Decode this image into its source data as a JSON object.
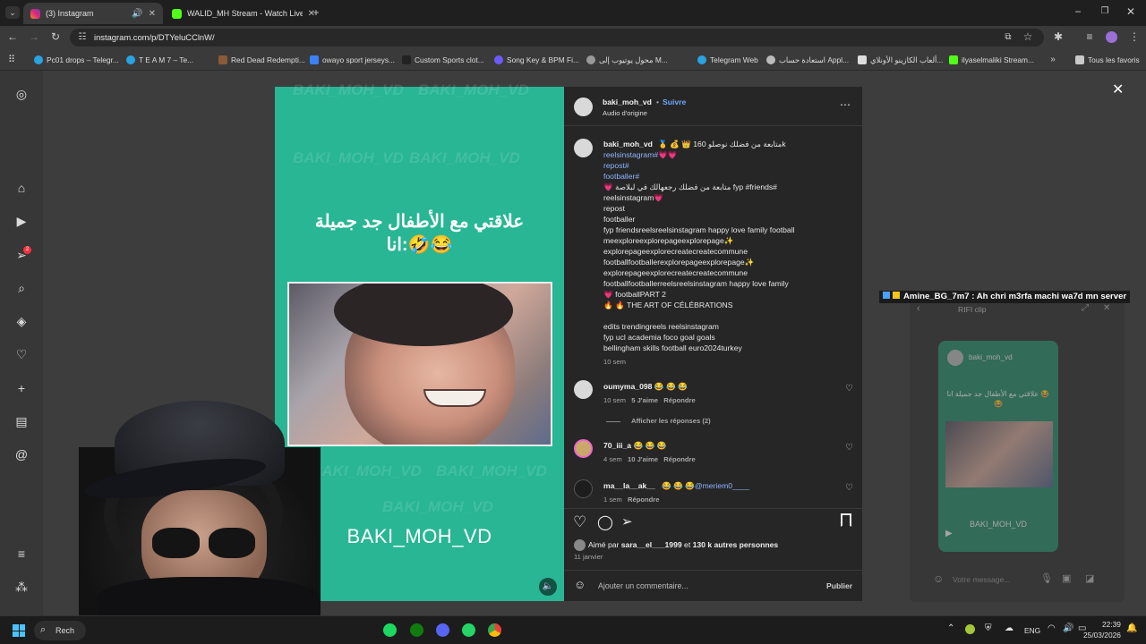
{
  "browser": {
    "tabs": [
      {
        "title": "(3) Instagram",
        "active": true
      },
      {
        "title": "WALID_MH Stream - Watch Live",
        "active": false
      }
    ],
    "url": "instagram.com/p/DTYeluCClnW/",
    "bookmarks": [
      "Pc01 drops – Telegr...",
      "T E A M 7 – Te...",
      "Red Dead Redempti...",
      "owayo sport jerseys...",
      "Custom Sports clot...",
      "Song Key & BPM Fi...",
      "محول يوتيوب إلى M...",
      "Telegram Web",
      "استعادة حساب Appl...",
      "ألعاب الكازينو الأونلاي...",
      "ilyaselmaliki Stream..."
    ],
    "all_bookmarks_label": "Tous les favoris"
  },
  "sidebar": {
    "notification_badge": "2"
  },
  "reel": {
    "watermark": "BAKI_MOH_VD",
    "caption_line1": "علاقتي مع الأطفال جد جميلة",
    "caption_line2": "انا:🤣😂",
    "username_overlay": "BAKI_MOH_VD"
  },
  "post": {
    "author": "baki_moh_vd",
    "follow_label": "Suivre",
    "audio": "Audio d'origine",
    "caption_author": "baki_moh_vd",
    "caption_lines": [
      {
        "text": "🥇 💰 👑 متابعة من فضلك نوصلو 160k",
        "cls": ""
      },
      {
        "text": "reelsinstagram#💗💗",
        "cls": "link"
      },
      {
        "text": "repost#",
        "cls": "link"
      },
      {
        "text": "footballer#",
        "cls": "link"
      },
      {
        "text": "💗 متابعة من فضلك رجعهالك في لبلاصة fyp #friends#",
        "cls": ""
      },
      {
        "text": "reelsinstagram💗",
        "cls": ""
      },
      {
        "text": "repost",
        "cls": ""
      },
      {
        "text": "footballer",
        "cls": ""
      },
      {
        "text": "fyp friendsreelsreelsinstagram happy love family football",
        "cls": ""
      },
      {
        "text": "meexploreexplorepageexplorepage✨",
        "cls": ""
      },
      {
        "text": "explorepageexplorecreatecreatecommune",
        "cls": ""
      },
      {
        "text": "footballfootballerexplorepageexplorepage✨",
        "cls": ""
      },
      {
        "text": "explorepageexplorecreatecreatecommune",
        "cls": ""
      },
      {
        "text": "footballfootballerreelsreelsinstagram happy love family",
        "cls": ""
      },
      {
        "text": "💗 footballPART 2",
        "cls": ""
      },
      {
        "text": "🔥 🔥 THE ART OF CÉLÉBRATIONS",
        "cls": ""
      },
      {
        "text": "",
        "cls": ""
      },
      {
        "text": "edits trendingreels reelsinstagram",
        "cls": ""
      },
      {
        "text": "fyp ucl academia foco goal goals",
        "cls": ""
      },
      {
        "text": "bellingham skills football euro2024turkey",
        "cls": ""
      }
    ],
    "caption_time": "10 sem",
    "comments": [
      {
        "user": "oumyma_098",
        "text": "😂 😂 😂",
        "time": "10 sem",
        "likes": "5 J'aime",
        "reply": "Répondre"
      },
      {
        "user": "70_iii_a",
        "text": "😂 😂 😂",
        "time": "4 sem",
        "likes": "10 J'aime",
        "reply": "Répondre"
      },
      {
        "user": "ma__la__ak__",
        "text": "😂 😂 😂",
        "mention": "@meriem0____",
        "time": "1 sem",
        "likes": "",
        "reply": "Répondre"
      }
    ],
    "show_replies": "Afficher les réponses (2)",
    "liked_by_prefix": "Aimé par",
    "liked_by_user": "sara__el___1999",
    "liked_by_suffix": "et",
    "liked_by_count": "130 k autres personnes",
    "date": "11 janvier",
    "comment_placeholder": "Ajouter un commentaire...",
    "publish_label": "Publier"
  },
  "chat": {
    "twitch_message": "Amine_BG_7m7 : Ah chri m3rfa machi wa7d mn server",
    "popup_title": "RIFI clip",
    "inner_username": "baki_moh_vd",
    "inner_caption": "علاقتي مع الأطفال جد جميلة انا 😂😂",
    "inner_footer": "BAKI_MOH_VD",
    "message_placeholder": "Votre message..."
  },
  "taskbar": {
    "search_label": "Rech",
    "language": "ENG",
    "time": "22:39",
    "date": "25/03/2026"
  },
  "colors": {
    "reel_bg": "#28b694",
    "link": "#8fb4ff",
    "follow": "#6ea8ff"
  }
}
